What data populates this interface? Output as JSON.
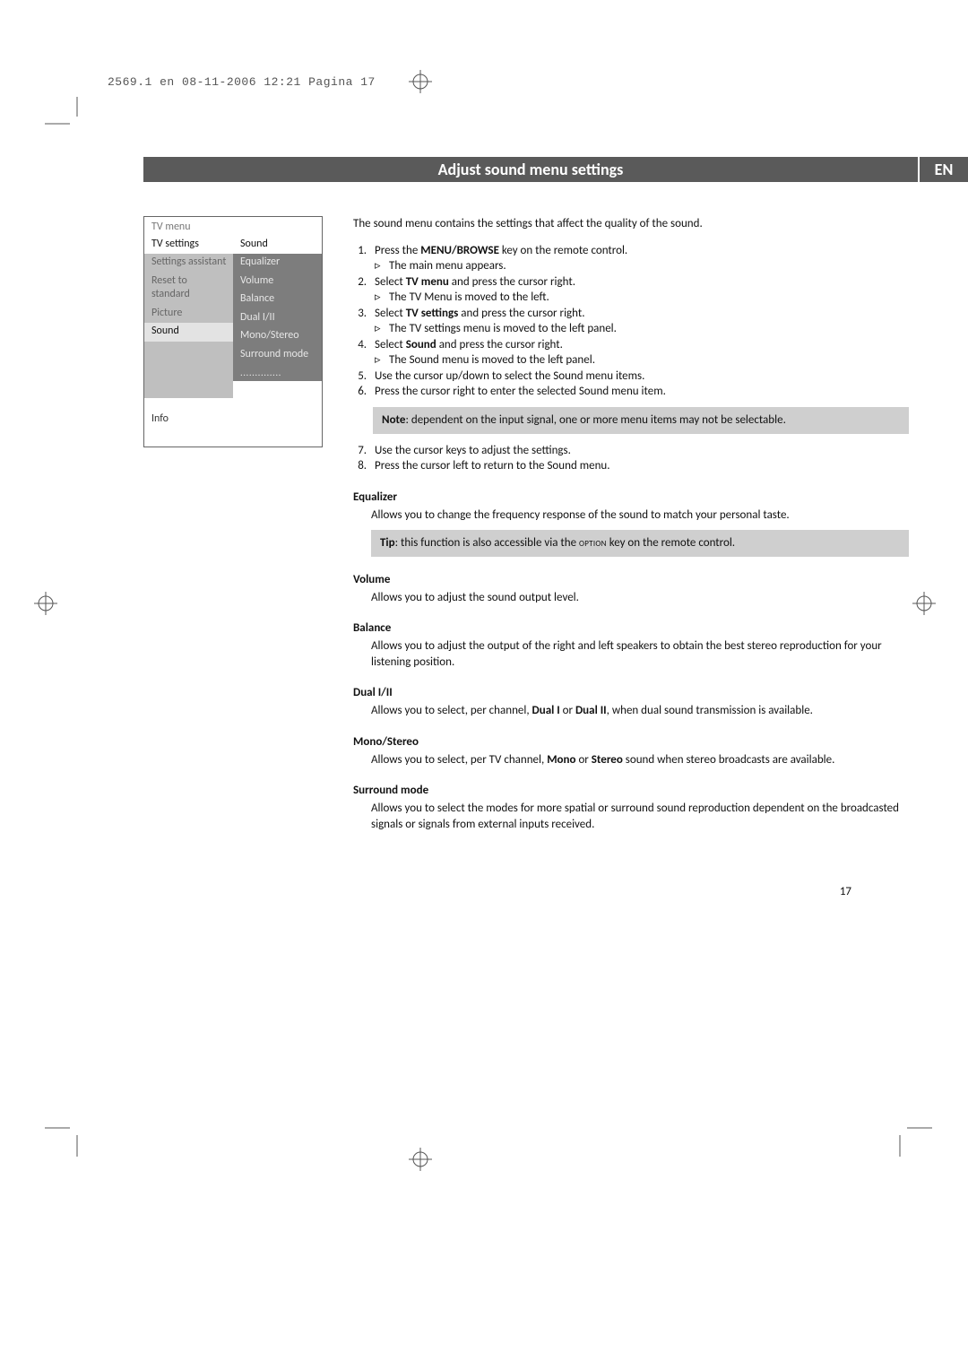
{
  "running_head": "2569.1 en  08-11-2006  12:21  Pagina 17",
  "header": {
    "title": "Adjust sound menu settings",
    "lang": "EN"
  },
  "menu": {
    "title": "TV menu",
    "left_first": "TV settings",
    "left_items": [
      "Settings assistant",
      "Reset to standard",
      "Picture"
    ],
    "left_active": "Sound",
    "right_header": "Sound",
    "right_items": [
      "Equalizer",
      "Volume",
      "Balance",
      "Dual I/II",
      "Mono/Stereo",
      "Surround mode"
    ],
    "right_dots": "..............",
    "info": "Info"
  },
  "intro": "The sound menu contains the settings that affect the quality of the sound.",
  "steps": {
    "s1": "Press the ",
    "s1_b": "MENU/BROWSE",
    "s1_after": " key on the remote control.",
    "s1_res": "The main menu appears.",
    "s2a": "Select ",
    "s2b": "TV menu",
    "s2c": " and press the cursor right.",
    "s2_res": "The TV Menu is moved to the left.",
    "s3a": "Select ",
    "s3b": "TV settings",
    "s3c": " and press the cursor right.",
    "s3_res": "The TV settings menu is moved to the left panel.",
    "s4a": "Select ",
    "s4b": "Sound",
    "s4c": " and press the cursor right.",
    "s4_res": "The Sound menu is moved to the left panel.",
    "s5": "Use the cursor up/down to select the Sound menu items.",
    "s6": "Press the cursor right to enter the selected Sound menu item.",
    "s7": "Use the cursor keys to adjust the settings.",
    "s8": "Press the cursor left to return to the Sound menu."
  },
  "note": {
    "b": "Note",
    "txt": ": dependent on the input signal, one or more menu items may not be selectable."
  },
  "tip": {
    "b": "Tip",
    "txt1": ": this function is also accessible via the ",
    "key": "OPTION",
    "txt2": " key on the remote control."
  },
  "sections": {
    "equalizer": {
      "h": "Equalizer",
      "body": "Allows you to change the frequency response of the sound to match your personal taste."
    },
    "volume": {
      "h": "Volume",
      "body": "Allows you to adjust the sound output level."
    },
    "balance": {
      "h": "Balance",
      "body": "Allows you to adjust the output of the right and left speakers to obtain the best stereo reproduction for your listening position."
    },
    "dual": {
      "h": "Dual I/II",
      "b1": "Allows you to select, per channel, ",
      "k1": "Dual I",
      "mid": " or ",
      "k2": "Dual II",
      "b2": ", when dual sound transmission is available."
    },
    "mono": {
      "h": "Mono/Stereo",
      "b1": "Allows you to select, per TV channel, ",
      "k1": "Mono",
      "mid": " or ",
      "k2": "Stereo",
      "b2": " sound when stereo broadcasts are available."
    },
    "surround": {
      "h": "Surround mode",
      "body": "Allows you to select the modes for more spatial or surround sound reproduction dependent on the broadcasted signals or signals from external inputs received."
    }
  },
  "result_mark": "▹",
  "page_number": "17"
}
